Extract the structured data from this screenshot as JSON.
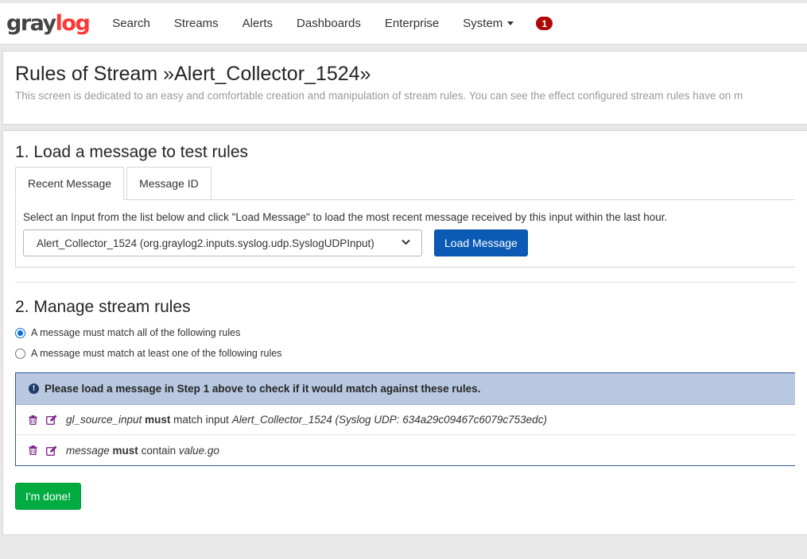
{
  "nav": {
    "brand_gray": "gray",
    "brand_log": "log",
    "items": [
      {
        "label": "Search"
      },
      {
        "label": "Streams"
      },
      {
        "label": "Alerts"
      },
      {
        "label": "Dashboards"
      },
      {
        "label": "Enterprise"
      },
      {
        "label": "System"
      }
    ],
    "notification_count": "1"
  },
  "header": {
    "title": "Rules of Stream »Alert_Collector_1524»",
    "description": "This screen is dedicated to an easy and comfortable creation and manipulation of stream rules. You can see the effect configured stream rules have on m"
  },
  "step1": {
    "title": "1. Load a message to test rules",
    "tabs": [
      {
        "label": "Recent Message",
        "active": true
      },
      {
        "label": "Message ID",
        "active": false
      }
    ],
    "description": "Select an Input from the list below and click \"Load Message\" to load the most recent message received by this input within the last hour.",
    "selected_input": "Alert_Collector_1524 (org.graylog2.inputs.syslog.udp.SyslogUDPInput)",
    "load_button": "Load Message"
  },
  "step2": {
    "title": "2. Manage stream rules",
    "radio_all": "A message must match all of the following rules",
    "radio_any": "A message must match at least one of the following rules",
    "alert": "Please load a message in Step 1 above to check if it would match against these rules.",
    "rules": [
      {
        "field": "gl_source_input",
        "must": "must",
        "verb": "match input",
        "value": "Alert_Collector_1524 (Syslog UDP: 634a29c09467c6079c753edc)"
      },
      {
        "field": "message",
        "must": "must",
        "verb": "contain",
        "value": "value.go"
      }
    ]
  },
  "done_button": "I'm done!",
  "colors": {
    "brand_red": "#ff3633",
    "primary_button": "#0b5ab5",
    "success_button": "#00ac3f",
    "rule_icon": "#7f2a8a",
    "alert_bg": "#b8c8e1",
    "badge": "#ad0707"
  }
}
